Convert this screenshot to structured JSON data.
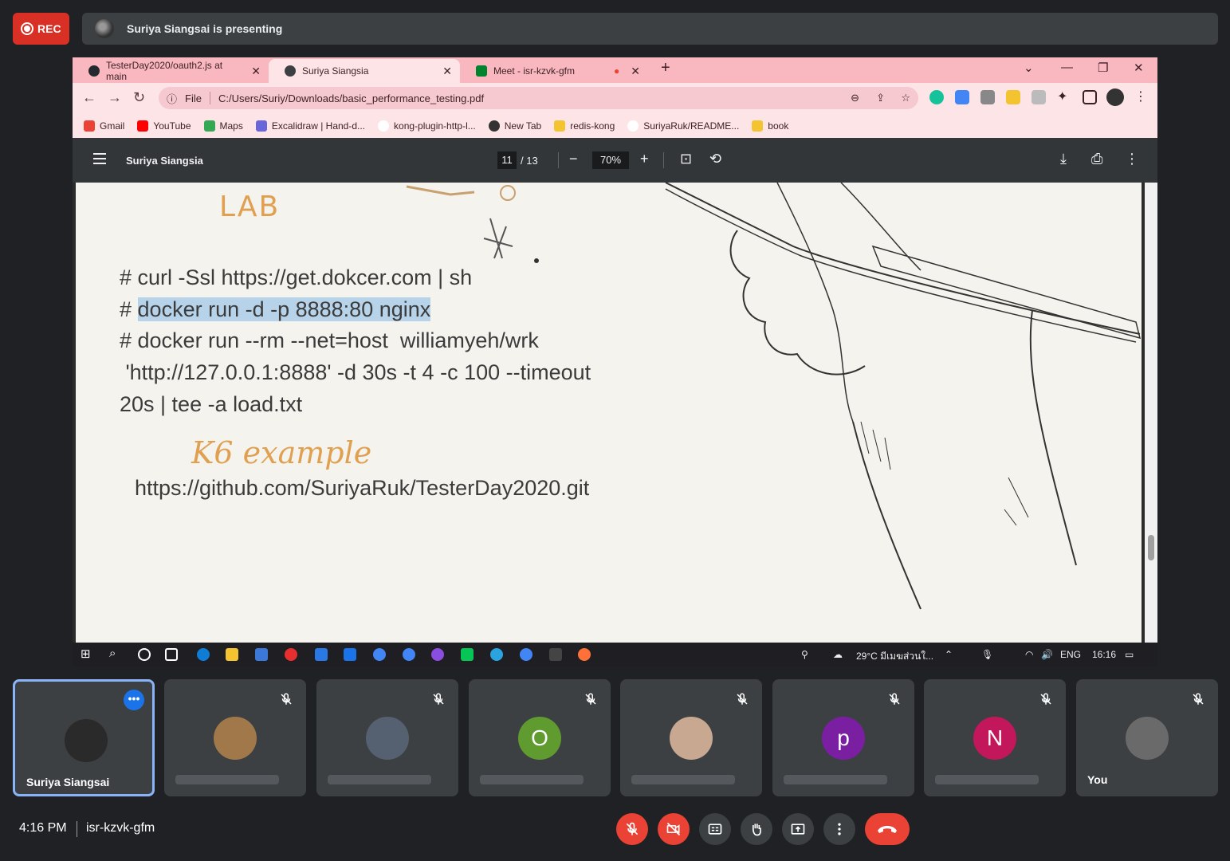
{
  "meet": {
    "rec_label": "REC",
    "presenting_text": "Suriya Siangsai is presenting",
    "time": "4:16 PM",
    "meeting_code": "isr-kzvk-gfm"
  },
  "browser": {
    "tabs": [
      {
        "label": "TesterDay2020/oauth2.js at main"
      },
      {
        "label": "Suriya Siangsia"
      },
      {
        "label": "Meet - isr-kzvk-gfm"
      }
    ],
    "omnibox_scheme": "File",
    "url": "C:/Users/Suriy/Downloads/basic_performance_testing.pdf",
    "bookmarks": [
      {
        "label": "Gmail",
        "color": "#ea4335"
      },
      {
        "label": "YouTube",
        "color": "#ff0000"
      },
      {
        "label": "Maps",
        "color": "#34a853"
      },
      {
        "label": "Excalidraw | Hand-d...",
        "color": "#6965db"
      },
      {
        "label": "kong-plugin-http-l...",
        "color": "#333333"
      },
      {
        "label": "New Tab",
        "color": "#333333"
      },
      {
        "label": "redis-kong",
        "color": "#f4c430"
      },
      {
        "label": "SuriyaRuk/README...",
        "color": "#333333"
      },
      {
        "label": "book",
        "color": "#f4c430"
      }
    ]
  },
  "pdf": {
    "title": "Suriya Siangsia",
    "current_page": "11",
    "total_pages": "/ 13",
    "zoom": "70%",
    "lab_heading": "LAB",
    "code_lines": [
      "# curl -Ssl https://get.dokcer.com | sh",
      "docker run -d -p 8888:80 nginx",
      "# docker run --rm --net=host  williamyeh/wrk",
      " 'http://127.0.0.1:8888' -d 30s -t 4 -c 100 --timeout",
      "20s | tee -a load.txt"
    ],
    "code_line2_prefix": "# ",
    "k6_heading": "K6 example",
    "github_link": "https://github.com/SuriyaRuk/TesterDay2020.git"
  },
  "taskbar": {
    "weather": "29°C  มีเมฆส่วนใ...",
    "lang": "ENG",
    "clock": "16:16"
  },
  "participants": [
    {
      "name": "Suriya Siangsai",
      "initial": "",
      "avatar_color": "#2a2a2a",
      "speaking": true
    },
    {
      "name": "",
      "initial": "",
      "avatar_color": "#a0784a",
      "speaking": false
    },
    {
      "name": "",
      "initial": "",
      "avatar_color": "#556070",
      "speaking": false
    },
    {
      "name": "",
      "initial": "O",
      "avatar_color": "#5f9b2f",
      "speaking": false
    },
    {
      "name": "",
      "initial": "",
      "avatar_color": "#c8a890",
      "speaking": false
    },
    {
      "name": "",
      "initial": "p",
      "avatar_color": "#7b1fa2",
      "speaking": false
    },
    {
      "name": "",
      "initial": "N",
      "avatar_color": "#c2185b",
      "speaking": false
    },
    {
      "name": "You",
      "initial": "",
      "avatar_color": "#6a6a6a",
      "speaking": false
    }
  ]
}
